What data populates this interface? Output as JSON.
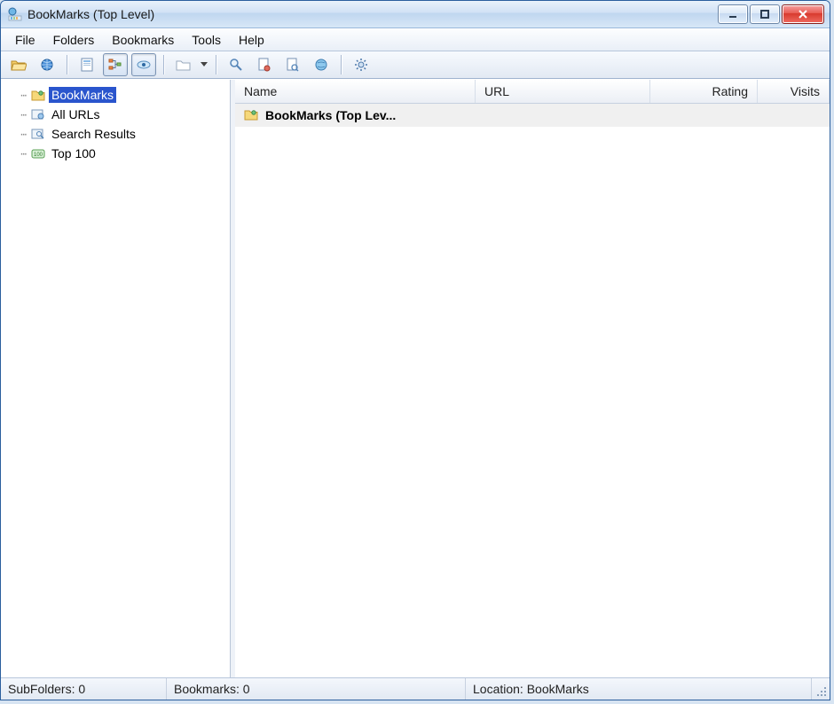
{
  "window": {
    "title": "BookMarks  (Top Level)"
  },
  "menu": {
    "items": [
      "File",
      "Folders",
      "Bookmarks",
      "Tools",
      "Help"
    ]
  },
  "toolbar": {
    "open_folder": "open-folder",
    "globe": "globe",
    "page_img": "page",
    "tree_toggle": "tree-toggle",
    "thumb_toggle": "thumb-toggle",
    "new_folder": "new-folder",
    "search": "search",
    "doc_red": "doc-red",
    "doc_mag": "doc-mag",
    "globe_small": "globe-small",
    "gear": "gear"
  },
  "tree": {
    "items": [
      {
        "label": "BookMarks",
        "icon": "bookmark-folder-icon",
        "selected": true
      },
      {
        "label": "All URLs",
        "icon": "urls-icon",
        "selected": false
      },
      {
        "label": "Search Results",
        "icon": "search-results-icon",
        "selected": false
      },
      {
        "label": "Top 100",
        "icon": "top100-icon",
        "selected": false
      }
    ]
  },
  "list": {
    "columns": {
      "name": "Name",
      "url": "URL",
      "rating": "Rating",
      "visits": "Visits"
    },
    "rows": [
      {
        "name": "BookMarks  (Top Lev...",
        "url": "",
        "rating": "",
        "visits": ""
      }
    ]
  },
  "status": {
    "subfolders": "SubFolders: 0",
    "bookmarks": "Bookmarks: 0",
    "location": "Location: BookMarks"
  }
}
